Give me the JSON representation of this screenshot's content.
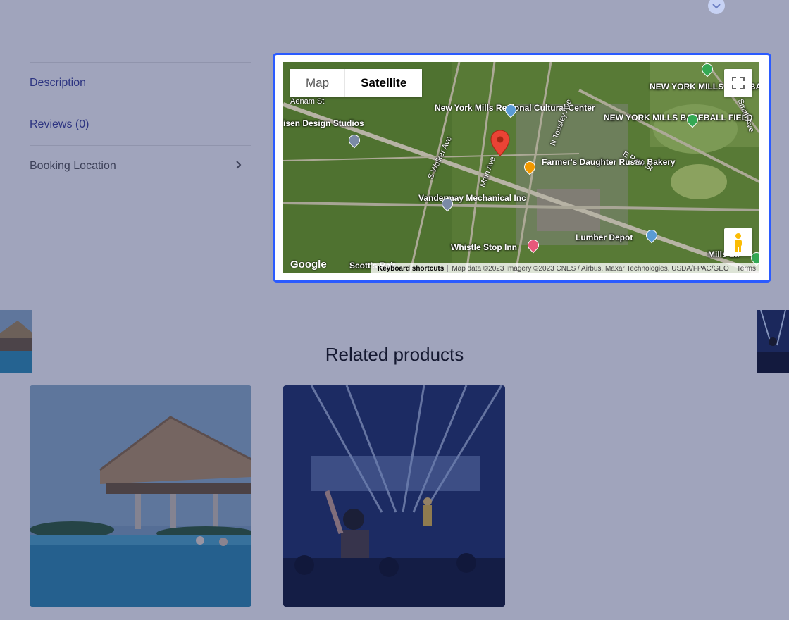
{
  "tabs": [
    {
      "label": "Description"
    },
    {
      "label": "Reviews (0)"
    },
    {
      "label": "Booking Location"
    }
  ],
  "map": {
    "type_map_label": "Map",
    "type_satellite_label": "Satellite",
    "google_label": "Google",
    "keyboard_shortcuts": "Keyboard shortcuts",
    "attribution": "Map data ©2023 Imagery ©2023 CNES / Airbus, Maxar Technologies, USDA/FPAC/GEO",
    "terms": "Terms",
    "places": {
      "football": "NEW YORK MILLS FOOTBALL FIELD",
      "baseball": "NEW YORK MILLS BASEBALL FIELD",
      "cultural": "New York Mills Regional Cultural Center",
      "studios": "isen Design Studios",
      "bakery": "Farmer's Daughter Rustic Bakery",
      "vandermay": "Vandermay Mechanical Inc",
      "lumber": "Lumber Depot",
      "whistle": "Whistle Stop Inn",
      "scotts": "Scott's Bait",
      "mills": "Mills La"
    },
    "streets": {
      "aenam": "Aenam St",
      "walker": "S Walker Ave",
      "main": "Main Ave",
      "tousley": "N Tousley Ave",
      "epark": "E Park St",
      "smith": "Smith Ave"
    }
  },
  "related": {
    "title": "Related products"
  },
  "colors": {
    "accent": "#2b5bff",
    "overlay": "#1c2660",
    "tab_link": "#3a3f9a",
    "main_pin": "#ea4335"
  }
}
